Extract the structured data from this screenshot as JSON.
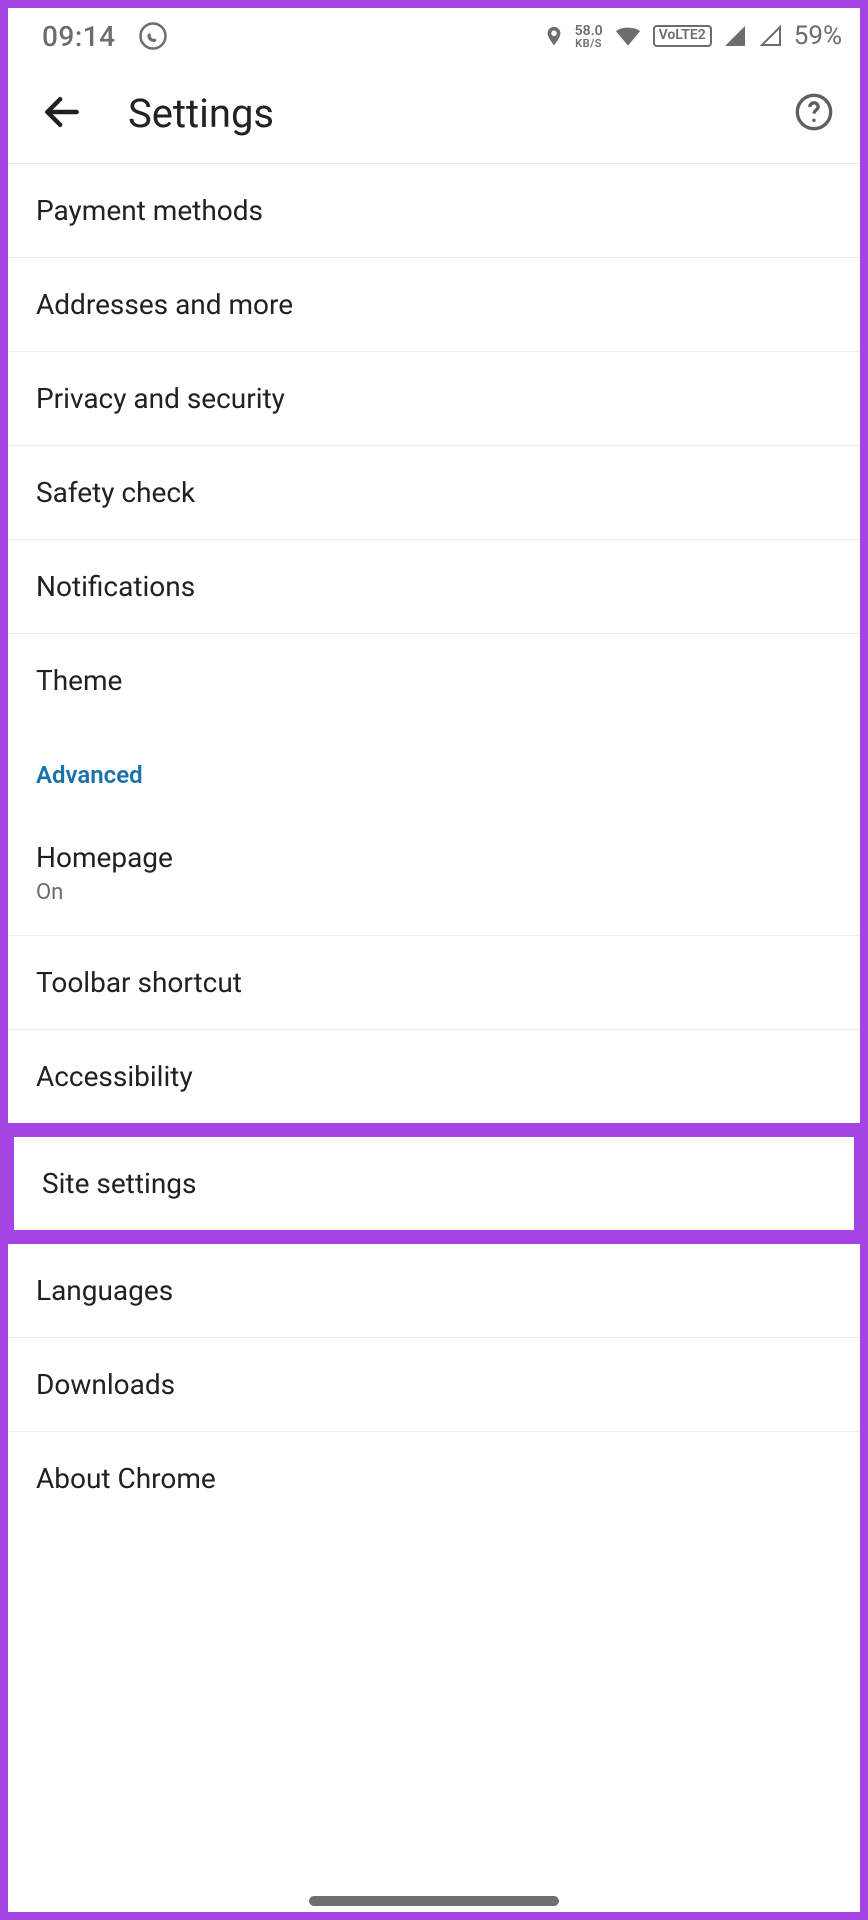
{
  "statusbar": {
    "time": "09:14",
    "whatsapp_icon": "whatsapp",
    "location_icon": "location",
    "net_speed_value": "58.0",
    "net_speed_unit": "KB/S",
    "wifi_icon": "wifi",
    "lte_badge": "VoLTE2",
    "signal_a": "signal-full",
    "signal_b": "signal-outline",
    "battery_pct": "59%"
  },
  "appbar": {
    "back_label": "Back",
    "title": "Settings",
    "help_label": "Help"
  },
  "rows": {
    "payment": "Payment methods",
    "addresses": "Addresses and more",
    "privacy": "Privacy and security",
    "safety": "Safety check",
    "notifications": "Notifications",
    "theme": "Theme",
    "advanced_header": "Advanced",
    "homepage_label": "Homepage",
    "homepage_sub": "On",
    "toolbar": "Toolbar shortcut",
    "accessibility": "Accessibility",
    "site_settings": "Site settings",
    "languages": "Languages",
    "downloads": "Downloads",
    "about": "About Chrome"
  }
}
